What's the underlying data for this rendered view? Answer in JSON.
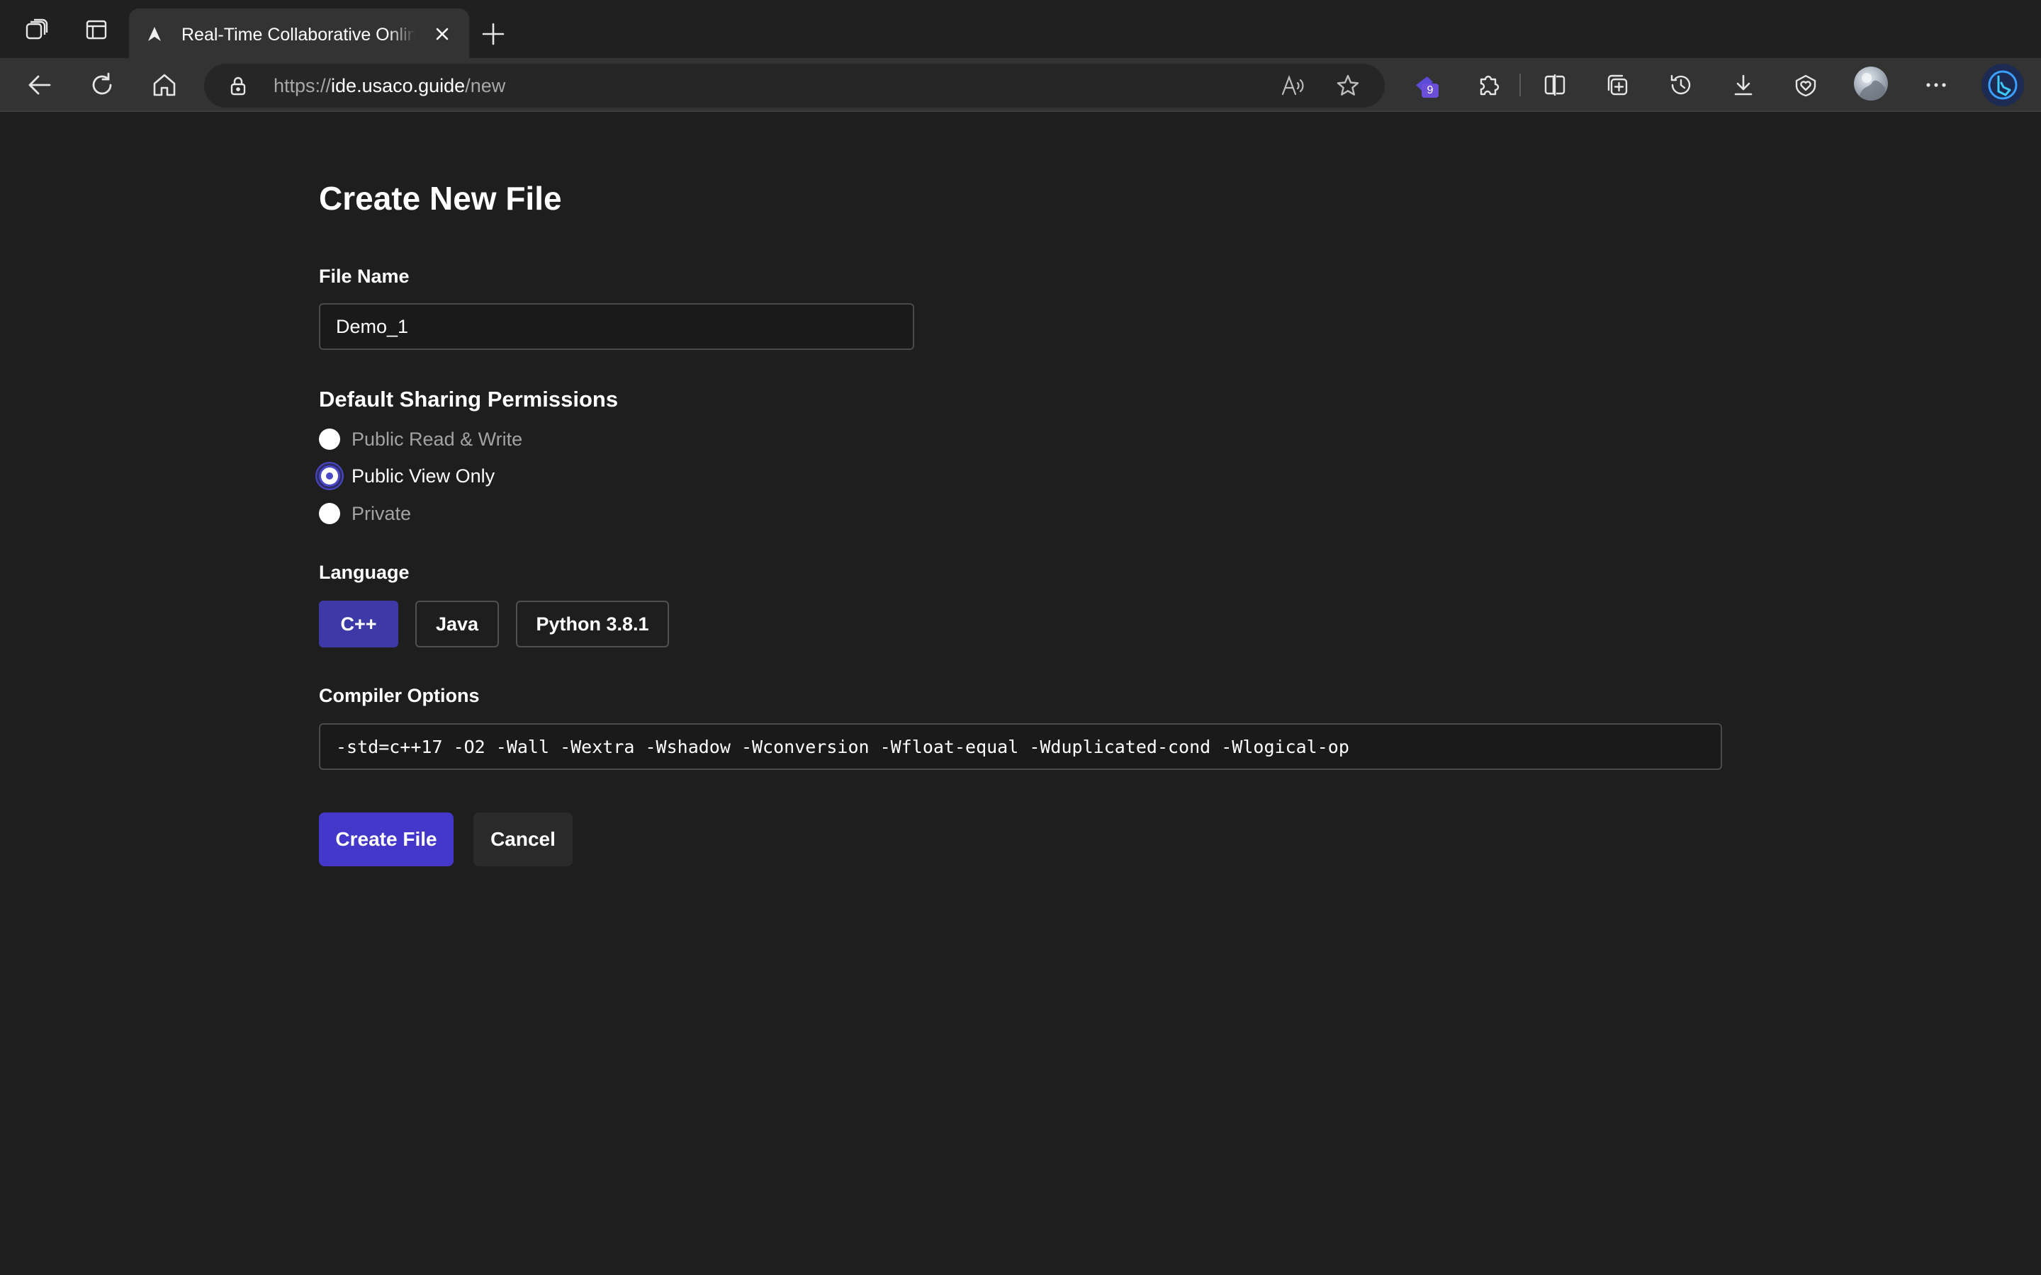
{
  "browser": {
    "tab": {
      "title": "Real-Time Collaborative Online IDE"
    },
    "address_bar": {
      "scheme": "https://",
      "host": "ide.usaco.guide",
      "path": "/new"
    },
    "extension_badge_count": "9",
    "icons": {
      "workspaces": "workspaces-icon",
      "tab_actions": "tab-actions-icon",
      "favicon": "usaco-favicon",
      "close": "close-icon",
      "new_tab": "plus-icon",
      "back": "back-arrow-icon",
      "refresh": "refresh-icon",
      "home": "home-icon",
      "lock": "lock-icon",
      "read_aloud": "read-aloud-icon",
      "favorite": "star-icon",
      "extension": "extension-icon",
      "extensions": "puzzle-icon",
      "split_screen": "split-screen-icon",
      "collections": "collections-icon",
      "history": "history-icon",
      "downloads": "download-icon",
      "browser_essentials": "heart-shield-icon",
      "profile": "avatar",
      "more": "more-icon",
      "copilot": "bing-copilot-icon"
    }
  },
  "form": {
    "title": "Create New File",
    "file_name": {
      "label": "File Name",
      "value": "Demo_1"
    },
    "sharing": {
      "heading": "Default Sharing Permissions",
      "options": [
        {
          "label": "Public Read & Write",
          "checked": false
        },
        {
          "label": "Public View Only",
          "checked": true
        },
        {
          "label": "Private",
          "checked": false
        }
      ]
    },
    "language": {
      "label": "Language",
      "options": [
        "C++",
        "Java",
        "Python 3.8.1"
      ],
      "selected": "C++"
    },
    "compiler_options": {
      "label": "Compiler Options",
      "value": "-std=c++17 -O2 -Wall -Wextra -Wshadow -Wconversion -Wfloat-equal -Wduplicated-cond -Wlogical-op"
    },
    "buttons": {
      "create": "Create File",
      "cancel": "Cancel"
    }
  },
  "colors": {
    "background": "#1e1e1e",
    "accent": "#4338ca",
    "selected_language": "#3d3aa8",
    "toolbar": "#333333"
  }
}
